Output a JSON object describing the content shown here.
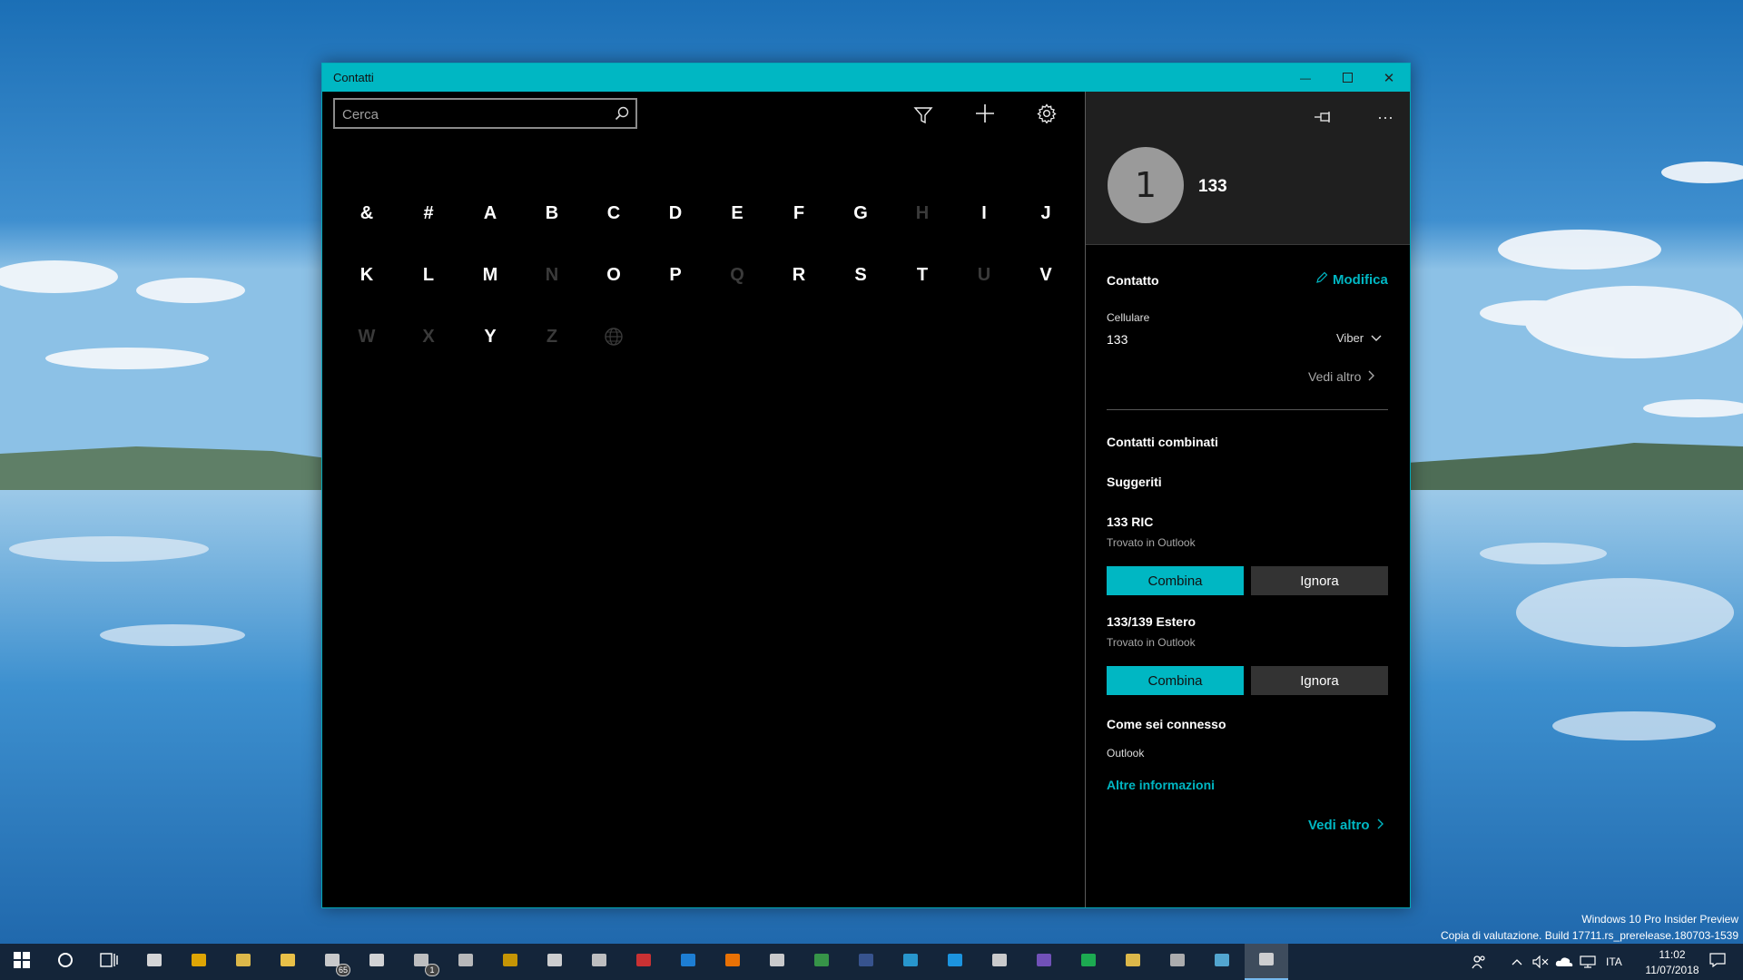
{
  "window": {
    "title": "Contatti",
    "minimize_symbol": "—",
    "close_symbol": "✕"
  },
  "search": {
    "placeholder": "Cerca"
  },
  "toolbar": {
    "icons": [
      "filter-icon",
      "add-icon",
      "settings-icon"
    ]
  },
  "alphabet": [
    {
      "label": "&",
      "enabled": true
    },
    {
      "label": "#",
      "enabled": true
    },
    {
      "label": "A",
      "enabled": true
    },
    {
      "label": "B",
      "enabled": true
    },
    {
      "label": "C",
      "enabled": true
    },
    {
      "label": "D",
      "enabled": true
    },
    {
      "label": "E",
      "enabled": true
    },
    {
      "label": "F",
      "enabled": true
    },
    {
      "label": "G",
      "enabled": true
    },
    {
      "label": "H",
      "enabled": false
    },
    {
      "label": "I",
      "enabled": true
    },
    {
      "label": "J",
      "enabled": true
    },
    {
      "label": "K",
      "enabled": true
    },
    {
      "label": "L",
      "enabled": true
    },
    {
      "label": "M",
      "enabled": true
    },
    {
      "label": "N",
      "enabled": false
    },
    {
      "label": "O",
      "enabled": true
    },
    {
      "label": "P",
      "enabled": true
    },
    {
      "label": "Q",
      "enabled": false
    },
    {
      "label": "R",
      "enabled": true
    },
    {
      "label": "S",
      "enabled": true
    },
    {
      "label": "T",
      "enabled": true
    },
    {
      "label": "U",
      "enabled": false
    },
    {
      "label": "V",
      "enabled": true
    },
    {
      "label": "W",
      "enabled": false
    },
    {
      "label": "X",
      "enabled": false
    },
    {
      "label": "Y",
      "enabled": true
    },
    {
      "label": "Z",
      "enabled": false
    },
    {
      "label": "",
      "enabled": false,
      "icon": "globe-icon"
    }
  ],
  "contact": {
    "avatar_initial": "1",
    "name": "133",
    "section_title": "Contatto",
    "edit_label": "Modifica",
    "phone_label": "Cellulare",
    "phone_value": "133",
    "phone_app": "Viber",
    "see_more_label": "Vedi altro"
  },
  "linked": {
    "title": "Contatti combinati",
    "suggested_title": "Suggeriti",
    "suggestions": [
      {
        "name": "133 RIC",
        "source": "Trovato in Outlook",
        "combine_label": "Combina",
        "ignore_label": "Ignora"
      },
      {
        "name": "133/139 Estero",
        "source": "Trovato in Outlook",
        "combine_label": "Combina",
        "ignore_label": "Ignora"
      }
    ],
    "connected_title": "Come sei connesso",
    "connected_value": "Outlook",
    "more_info_label": "Altre informazioni",
    "see_more_label": "Vedi altro"
  },
  "watermark": {
    "line1": "Windows 10 Pro Insider Preview",
    "line2": "Copia di valutazione. Build 17711.rs_prerelease.180703-1539"
  },
  "taskbar": {
    "icons": [
      "start-icon",
      "cortana-icon",
      "task-view-icon",
      "app-icon",
      "chrome-icon",
      "file-explorer-icon",
      "store-icon",
      "mail-icon",
      "settings-icon",
      "news-icon",
      "paint-icon",
      "download-icon",
      "remote-desktop-icon",
      "phone-icon",
      "app-icon",
      "app-icon",
      "soundcloud-icon",
      "app-icon",
      "facebook-icon",
      "telegram-icon",
      "twitter-icon",
      "people-share-icon",
      "app-icon",
      "spotify-icon",
      "folder-icon",
      "app-icon",
      "app-icon",
      "tablet-icon",
      "people-icon"
    ],
    "mail_badge": "65",
    "news_badge": "1",
    "language": "ITA",
    "time": "11:02",
    "date": "11/07/2018"
  },
  "colors": {
    "accent": "#00b7c3",
    "window_bg": "#000000",
    "header_bg": "#1f1f1f",
    "button_secondary": "#333333"
  }
}
